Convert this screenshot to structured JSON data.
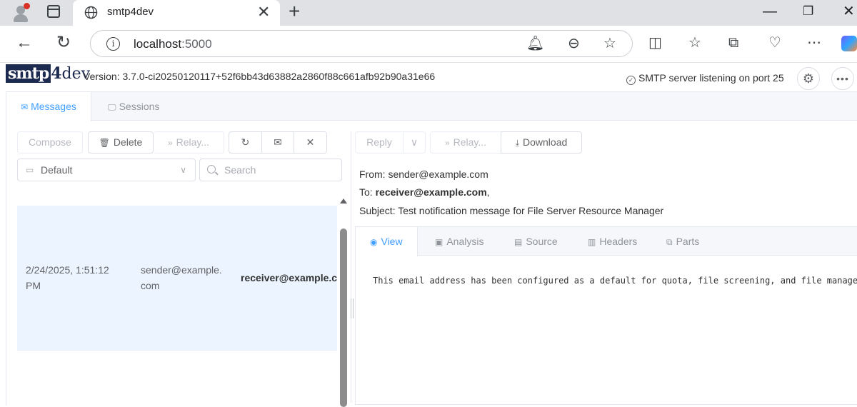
{
  "browser": {
    "tab_title": "smtp4dev",
    "url_host": "localhost",
    "url_port": ":5000"
  },
  "app": {
    "version": "Version: 3.7.0-ci20250120117+52f6bb43d63882a2860f88c661afb92b90a31e66",
    "server_status": "SMTP server listening on port 25",
    "main_tabs": [
      {
        "label": "Messages",
        "active": true
      },
      {
        "label": "Sessions",
        "active": false
      }
    ]
  },
  "list_toolbar": {
    "compose": "Compose",
    "delete": "Delete",
    "relay": "Relay..."
  },
  "mailbox_select": {
    "value": "Default"
  },
  "search": {
    "placeholder": "Search"
  },
  "messages": [
    {
      "received": "2/24/2025, 1:51:12 PM",
      "from": "sender@example.com",
      "to": "receiver@example.com"
    }
  ],
  "message_toolbar": {
    "reply": "Reply",
    "relay": "Relay...",
    "download": "Download"
  },
  "message": {
    "from_label": "From:",
    "from": "sender@example.com",
    "to_label": "To:",
    "to": "receiver@example.com",
    "to_suffix": ",",
    "subject_label": "Subject:",
    "subject": "Test notification message for File Server Resource Manager",
    "body": "This email address has been configured as a default for quota, file screening, and file management"
  },
  "view_tabs": [
    {
      "label": "View",
      "active": true
    },
    {
      "label": "Analysis",
      "active": false
    },
    {
      "label": "Source",
      "active": false
    },
    {
      "label": "Headers",
      "active": false
    },
    {
      "label": "Parts",
      "active": false
    }
  ],
  "colors": {
    "accent": "#409eff",
    "selected_row": "#ecf5ff"
  }
}
